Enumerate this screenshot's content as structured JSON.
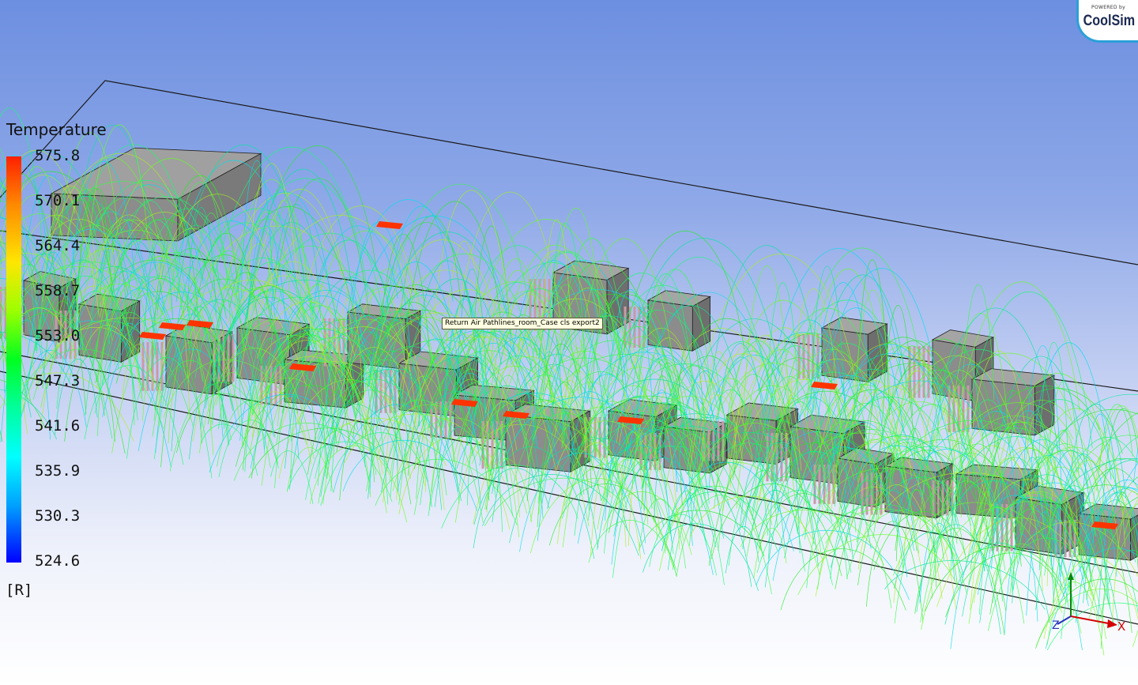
{
  "legend": {
    "title": "Temperature",
    "ticks": [
      "575.8",
      "570.1",
      "564.4",
      "558.7",
      "553.0",
      "547.3",
      "541.6",
      "535.9",
      "530.3",
      "524.6"
    ],
    "unit": "[R]",
    "colors": {
      "max": "#ff2000",
      "mid": "#00ff20",
      "min": "#0000ff"
    }
  },
  "tooltip": {
    "text": "Return Air Pathlines_room_Case cls export2"
  },
  "logo": {
    "powered": "POWERED by",
    "brand": "CoolSim"
  },
  "axes": {
    "x_label": "X",
    "z_label": "Z"
  },
  "scene": {
    "streamline_colors": [
      "#22ee22",
      "#33ff44",
      "#00e8a0",
      "#00ddee",
      "#66ff22",
      "#aaf020",
      "#10ff70"
    ],
    "box_color": "#8c8c8c",
    "hot_spot_color": "#ff3300"
  }
}
